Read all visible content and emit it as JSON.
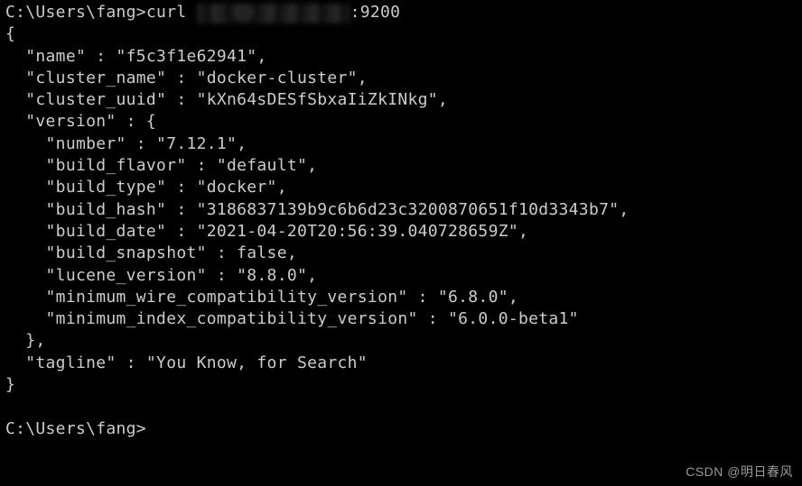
{
  "prompt": {
    "path": "C:\\Users\\fang>",
    "command": "curl ",
    "port": ":9200"
  },
  "response": {
    "open_brace": "{",
    "name_line": "  \"name\" : \"f5c3f1e62941\",",
    "cluster_name_line": "  \"cluster_name\" : \"docker-cluster\",",
    "cluster_uuid_line": "  \"cluster_uuid\" : \"kXn64sDESfSbxaIiZkINkg\",",
    "version_open": "  \"version\" : {",
    "number_line": "    \"number\" : \"7.12.1\",",
    "build_flavor_line": "    \"build_flavor\" : \"default\",",
    "build_type_line": "    \"build_type\" : \"docker\",",
    "build_hash_line": "    \"build_hash\" : \"3186837139b9c6b6d23c3200870651f10d3343b7\",",
    "build_date_line": "    \"build_date\" : \"2021-04-20T20:56:39.040728659Z\",",
    "build_snapshot_line": "    \"build_snapshot\" : false,",
    "lucene_version_line": "    \"lucene_version\" : \"8.8.0\",",
    "min_wire_line": "    \"minimum_wire_compatibility_version\" : \"6.8.0\",",
    "min_index_line": "    \"minimum_index_compatibility_version\" : \"6.0.0-beta1\"",
    "version_close": "  },",
    "tagline_line": "  \"tagline\" : \"You Know, for Search\"",
    "close_brace": "}"
  },
  "prompt2": {
    "path": "C:\\Users\\fang>"
  },
  "watermark": "CSDN @明日春风"
}
